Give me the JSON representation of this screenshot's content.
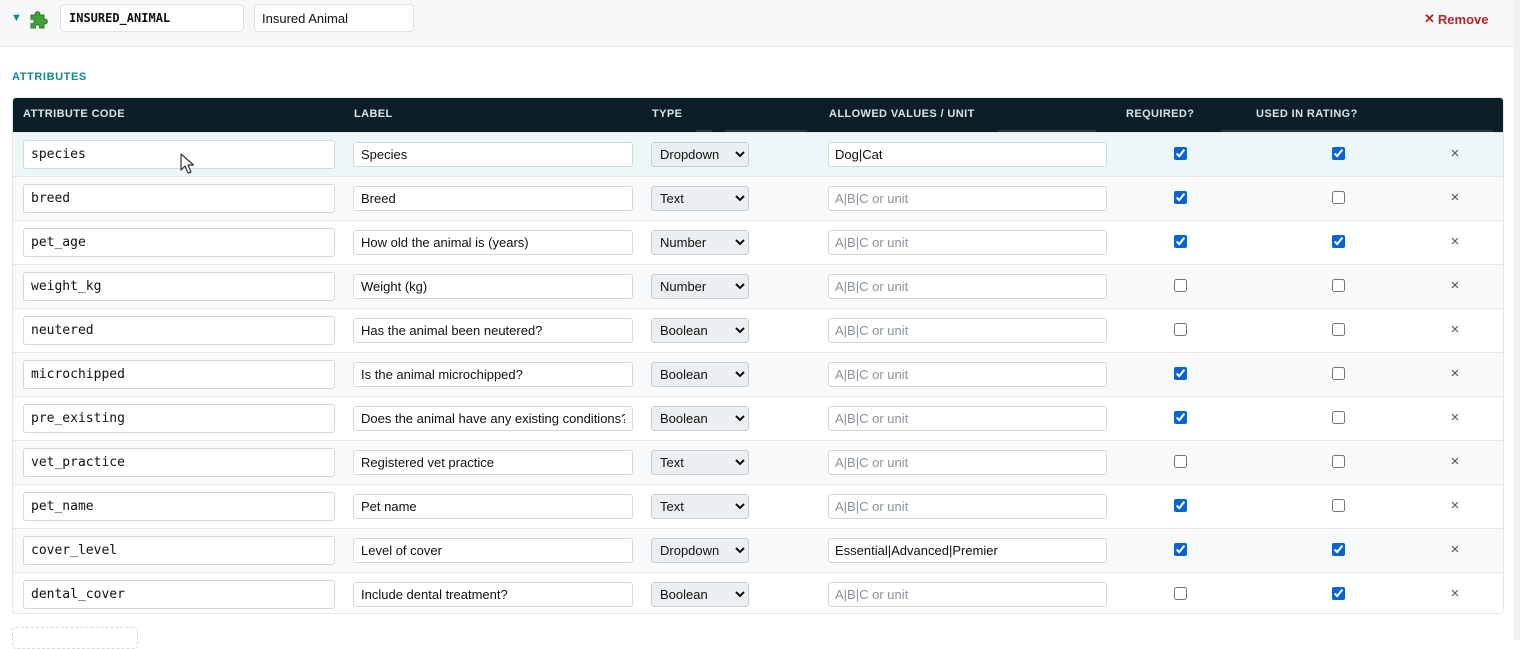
{
  "entity": {
    "code": "INSURED_ANIMAL",
    "label": "Insured Animal",
    "collapse_glyph": "▼",
    "icon": "puzzle-icon",
    "remove_glyph": "✕",
    "remove_label": "Remove",
    "remove_color": "#b02a2a"
  },
  "section": {
    "title": "ATTRIBUTES"
  },
  "table": {
    "headers": {
      "code": "ATTRIBUTE CODE",
      "label": "LABEL",
      "type": "TYPE",
      "allowed": "ALLOWED VALUES / UNIT",
      "required": "REQUIRED?",
      "rating": "USED IN RATING?"
    },
    "header_bg": "#0d1f26",
    "accent": "#128a86",
    "type_options": [
      "Text",
      "Number",
      "Dropdown",
      "Boolean"
    ],
    "allowed_placeholder": "A|B|C or unit",
    "delete_glyph": "×",
    "rows": [
      {
        "code": "species",
        "label": "Species",
        "type": "Dropdown",
        "allowed": "Dog|Cat",
        "required": true,
        "rating": true
      },
      {
        "code": "breed",
        "label": "Breed",
        "type": "Text",
        "allowed": "",
        "required": true,
        "rating": false
      },
      {
        "code": "pet_age",
        "label": "How old the animal is (years)",
        "type": "Number",
        "allowed": "",
        "required": true,
        "rating": true
      },
      {
        "code": "weight_kg",
        "label": "Weight (kg)",
        "type": "Number",
        "allowed": "",
        "required": false,
        "rating": false
      },
      {
        "code": "neutered",
        "label": "Has the animal been neutered?",
        "type": "Boolean",
        "allowed": "",
        "required": false,
        "rating": false
      },
      {
        "code": "microchipped",
        "label": "Is the animal microchipped?",
        "type": "Boolean",
        "allowed": "",
        "required": true,
        "rating": false
      },
      {
        "code": "pre_existing",
        "label": "Does the animal have any existing conditions?",
        "type": "Boolean",
        "allowed": "",
        "required": true,
        "rating": false
      },
      {
        "code": "vet_practice",
        "label": "Registered vet practice",
        "type": "Text",
        "allowed": "",
        "required": false,
        "rating": false
      },
      {
        "code": "pet_name",
        "label": "Pet name",
        "type": "Text",
        "allowed": "",
        "required": true,
        "rating": false
      },
      {
        "code": "cover_level",
        "label": "Level of cover",
        "type": "Dropdown",
        "allowed": "Essential|Advanced|Premier",
        "required": true,
        "rating": true
      },
      {
        "code": "dental_cover",
        "label": "Include dental treatment?",
        "type": "Boolean",
        "allowed": "",
        "required": false,
        "rating": true
      }
    ]
  }
}
